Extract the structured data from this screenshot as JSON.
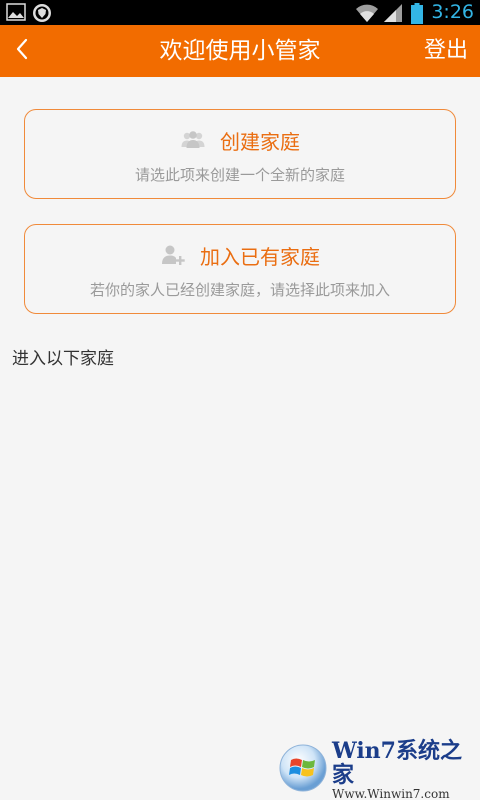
{
  "status_bar": {
    "time": "3:26",
    "icons": [
      "image-icon",
      "shield-icon",
      "wifi-icon",
      "signal-icon",
      "battery-icon"
    ]
  },
  "header": {
    "back_icon": "chevron-left-icon",
    "title": "欢迎使用小管家",
    "logout_label": "登出"
  },
  "options": {
    "create": {
      "icon": "group-icon",
      "title": "创建家庭",
      "description": "请选此项来创建一个全新的家庭"
    },
    "join": {
      "icon": "add-user-icon",
      "title": "加入已有家庭",
      "description": "若你的家人已经创建家庭，请选择此项来加入"
    }
  },
  "section": {
    "label": "进入以下家庭"
  },
  "watermark": {
    "brand": "Win7系统之家",
    "url": "Www.Winwin7.com"
  },
  "colors": {
    "accent": "#f26c00",
    "card_border": "#f08a3a",
    "card_title": "#ea6e12",
    "muted_text": "#9a9a9a",
    "background": "#f5f5f5"
  }
}
